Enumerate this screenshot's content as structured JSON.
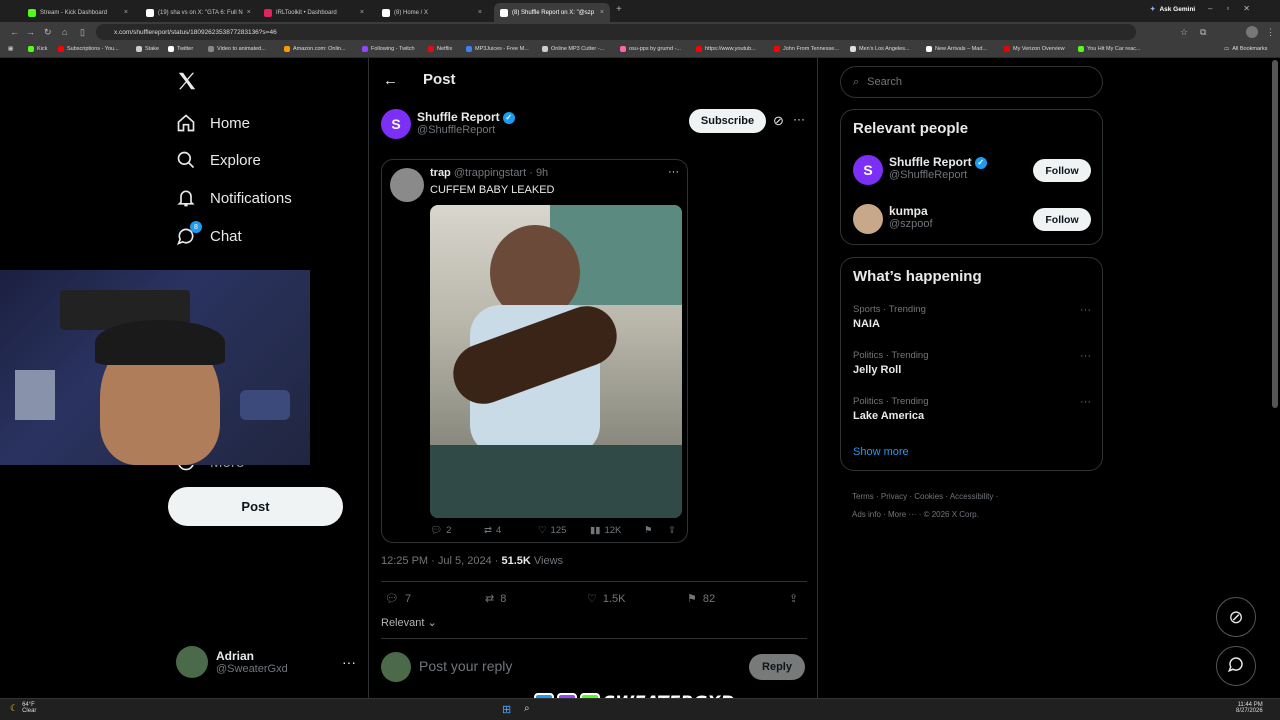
{
  "browser": {
    "tabs": [
      {
        "title": "Stream - Kick Dashboard",
        "color": "#53fc18"
      },
      {
        "title": "(19) sha vs on X: \"GTA 6: Full N",
        "color": "#ffffff"
      },
      {
        "title": "IRLToolkit • Dashboard",
        "color": "#e0245e"
      },
      {
        "title": "(8) Home / X",
        "color": "#ffffff"
      },
      {
        "title": "(8) Shuffle Report on X: \"@szp",
        "color": "#ffffff"
      }
    ],
    "ask_gemini": "Ask Gemini",
    "url": "x.com/shufflereport/status/1809262353877283136?s=46",
    "bookmarks": [
      {
        "label": "Kick",
        "color": "#53fc18"
      },
      {
        "label": "Subscriptions - You...",
        "color": "#ff0000"
      },
      {
        "label": "Stake",
        "color": "#cccccc"
      },
      {
        "label": "Twitter",
        "color": "#ffffff"
      },
      {
        "label": "Video to animated...",
        "color": "#888888"
      },
      {
        "label": "Amazon.com: Onlin...",
        "color": "#ff9900"
      },
      {
        "label": "Following - Twitch",
        "color": "#9146ff"
      },
      {
        "label": "Netflix",
        "color": "#e50914"
      },
      {
        "label": "MP3Juices - Free M...",
        "color": "#3b82f6"
      },
      {
        "label": "Online MP3 Cutter -...",
        "color": "#cccccc"
      },
      {
        "label": "osu-pps by grumd -...",
        "color": "#ff66aa"
      },
      {
        "label": "https://www.youtub...",
        "color": "#ff0000"
      },
      {
        "label": "John From Tennesse...",
        "color": "#ff0000"
      },
      {
        "label": "Men's Los Angeles...",
        "color": "#dddddd"
      },
      {
        "label": "New Arrivals – Mad...",
        "color": "#ffffff"
      },
      {
        "label": "My Verizon Overview",
        "color": "#ee0000"
      },
      {
        "label": "You Hit My Car reac...",
        "color": "#53fc18"
      }
    ],
    "all_bookmarks": "All Bookmarks"
  },
  "nav": {
    "items": [
      {
        "label": "Home",
        "icon": "home-icon"
      },
      {
        "label": "Explore",
        "icon": "search-icon"
      },
      {
        "label": "Notifications",
        "icon": "bell-icon"
      },
      {
        "label": "Chat",
        "icon": "chat-icon",
        "badge": "8"
      },
      {
        "label": "More",
        "icon": "more-circle-icon"
      }
    ],
    "post_label": "Post",
    "user": {
      "name": "Adrian",
      "handle": "@SweaterGxd"
    }
  },
  "main": {
    "header_title": "Post",
    "author": {
      "name": "Shuffle Report",
      "handle": "@ShuffleReport",
      "avatar": "S"
    },
    "subscribe_label": "Subscribe",
    "quoted": {
      "name": "trap",
      "handle": "@trappingstart",
      "time": "9h",
      "text": "CUFFEM BABY LEAKED",
      "stats": {
        "replies": "2",
        "reposts": "4",
        "likes": "125",
        "views": "12K"
      }
    },
    "meta": {
      "time": "12:25 PM · Jul 5, 2024 · ",
      "views_count": "51.5K",
      "views_label": "Views"
    },
    "stats": {
      "replies": "7",
      "reposts": "8",
      "likes": "1.5K",
      "bookmarks": "82"
    },
    "sort_label": "Relevant",
    "reply_placeholder": "Post your reply",
    "reply_label": "Reply"
  },
  "right": {
    "search_placeholder": "Search",
    "relevant_title": "Relevant people",
    "people": [
      {
        "name": "Shuffle Report",
        "handle": "@ShuffleReport",
        "follow": "Follow"
      },
      {
        "name": "kumpa",
        "handle": "@szpoof",
        "follow": "Follow"
      }
    ],
    "happening_title": "What’s happening",
    "trends": [
      {
        "context": "Sports · Trending",
        "name": "NAIA"
      },
      {
        "context": "Politics · Trending",
        "name": "Jelly Roll"
      },
      {
        "context": "Politics · Trending",
        "name": "Lake America"
      }
    ],
    "show_more": "Show more",
    "footer": [
      "Terms",
      "Privacy",
      "Cookies",
      "Accessibility",
      "Ads info",
      "More ···",
      "© 2026 X Corp."
    ]
  },
  "stream_overlay": {
    "brand_text": "SWEATERGXD"
  },
  "taskbar": {
    "weather_temp": "64°F",
    "weather_desc": "Clear",
    "clock_time": "11:44 PM",
    "clock_date": "8/27/2026"
  }
}
